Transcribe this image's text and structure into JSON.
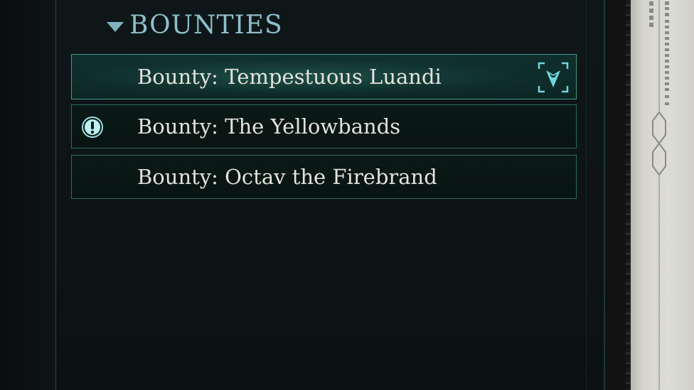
{
  "section": {
    "title": "BOUNTIES",
    "expanded": true
  },
  "quests": [
    {
      "label": "Bounty: Tempestuous Luandi",
      "selected": true,
      "tracked": true,
      "alert": false
    },
    {
      "label": "Bounty: The Yellowbands",
      "selected": false,
      "tracked": false,
      "alert": true
    },
    {
      "label": "Bounty: Octav the Firebrand",
      "selected": false,
      "tracked": false,
      "alert": false
    }
  ],
  "icons": {
    "chevron": "chevron-down-icon",
    "alert": "exclamation-icon",
    "tracked": "tracked-quest-icon"
  },
  "colors": {
    "accent": "#3c9b8c",
    "header_text": "#8ebfcb",
    "item_text": "#e4e2dc",
    "icon_cyan": "#6fd6dc"
  }
}
